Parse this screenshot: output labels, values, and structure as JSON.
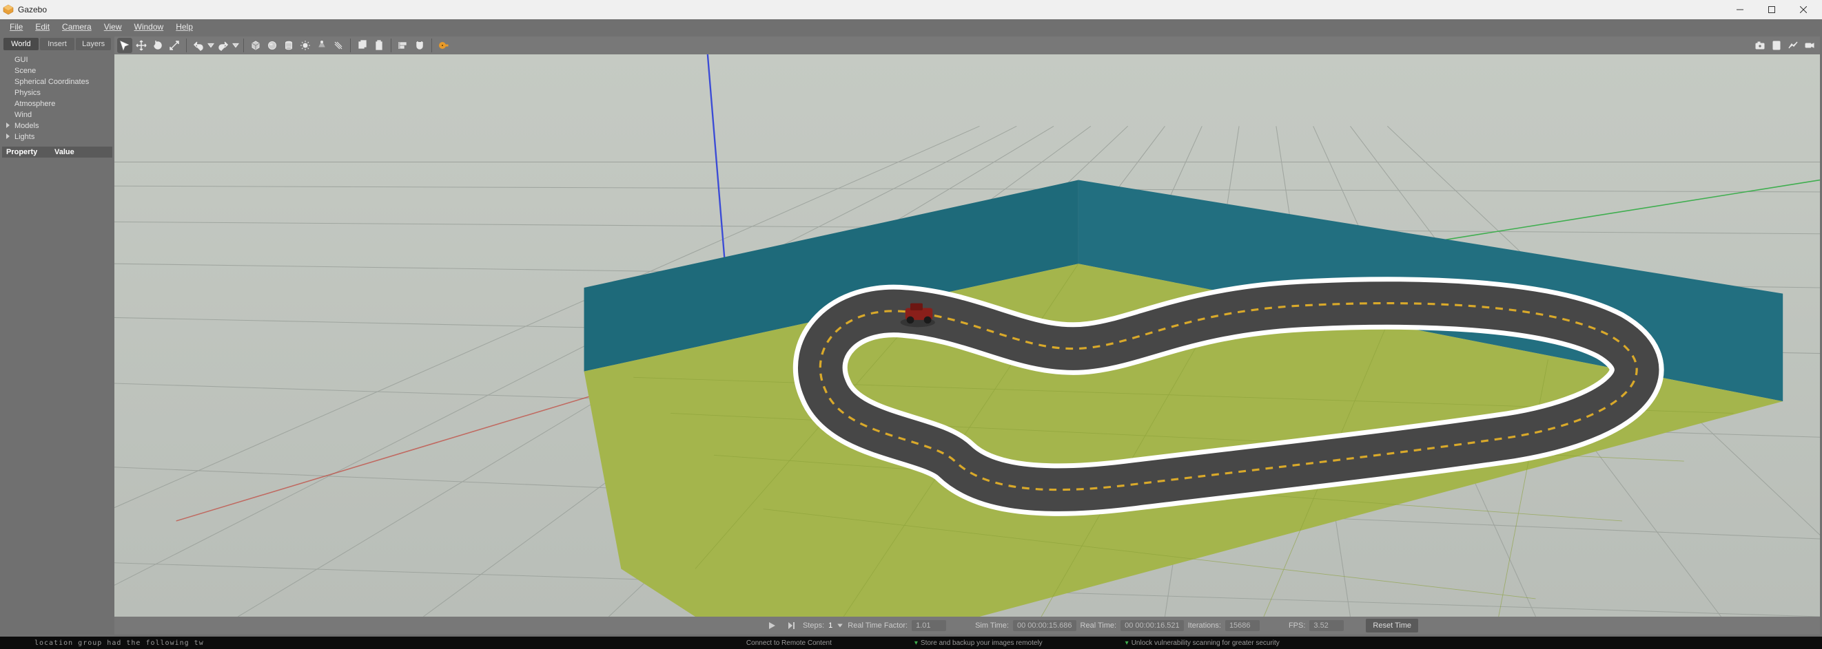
{
  "window": {
    "title": "Gazebo"
  },
  "menus": [
    "File",
    "Edit",
    "Camera",
    "View",
    "Window",
    "Help"
  ],
  "sidebar": {
    "tabs": [
      {
        "label": "World",
        "active": true
      },
      {
        "label": "Insert",
        "active": false
      },
      {
        "label": "Layers",
        "active": false
      }
    ],
    "tree": [
      "GUI",
      "Scene",
      "Spherical Coordinates",
      "Physics",
      "Atmosphere",
      "Wind",
      "Models",
      "Lights"
    ],
    "tree_caret": {
      "Models": true,
      "Lights": true
    },
    "propHeaders": {
      "prop": "Property",
      "val": "Value"
    }
  },
  "toolbar": {
    "tools": [
      {
        "name": "select",
        "icon": "arrow",
        "active": true
      },
      {
        "name": "translate",
        "icon": "move"
      },
      {
        "name": "rotate",
        "icon": "rotate"
      },
      {
        "name": "scale",
        "icon": "scale"
      },
      {
        "name": "sep"
      },
      {
        "name": "undo",
        "icon": "undo"
      },
      {
        "name": "undo-menu",
        "icon": "tri"
      },
      {
        "name": "redo",
        "icon": "redo"
      },
      {
        "name": "redo-menu",
        "icon": "tri"
      },
      {
        "name": "sep"
      },
      {
        "name": "box",
        "icon": "box"
      },
      {
        "name": "sphere",
        "icon": "sphere"
      },
      {
        "name": "cylinder",
        "icon": "cylinder"
      },
      {
        "name": "sun",
        "icon": "sun"
      },
      {
        "name": "spot",
        "icon": "spot"
      },
      {
        "name": "directional",
        "icon": "dir"
      },
      {
        "name": "sep"
      },
      {
        "name": "copy",
        "icon": "copy"
      },
      {
        "name": "paste",
        "icon": "paste"
      },
      {
        "name": "sep"
      },
      {
        "name": "align",
        "icon": "align"
      },
      {
        "name": "snap",
        "icon": "snap"
      },
      {
        "name": "sep"
      },
      {
        "name": "tape",
        "icon": "tape",
        "orange": true
      }
    ],
    "right": [
      {
        "name": "screenshot",
        "icon": "camera"
      },
      {
        "name": "log",
        "icon": "save"
      },
      {
        "name": "plot",
        "icon": "plot"
      },
      {
        "name": "record",
        "icon": "record"
      }
    ]
  },
  "status": {
    "steps_label": "Steps:",
    "steps": "1",
    "rtf_label": "Real Time Factor:",
    "rtf": "1.01",
    "simtime_label": "Sim Time:",
    "simtime": "00 00:00:15.686",
    "realtime_label": "Real Time:",
    "realtime": "00 00:00:16.521",
    "iter_label": "Iterations:",
    "iter": "15686",
    "fps_label": "FPS:",
    "fps": "3.52",
    "reset": "Reset Time"
  },
  "bottom": {
    "left": "location group had the following tw",
    "mid1": "Connect to Remote Content",
    "mid2": "Store and backup your images remotely",
    "mid3": "Unlock vulnerability scanning for greater security"
  }
}
